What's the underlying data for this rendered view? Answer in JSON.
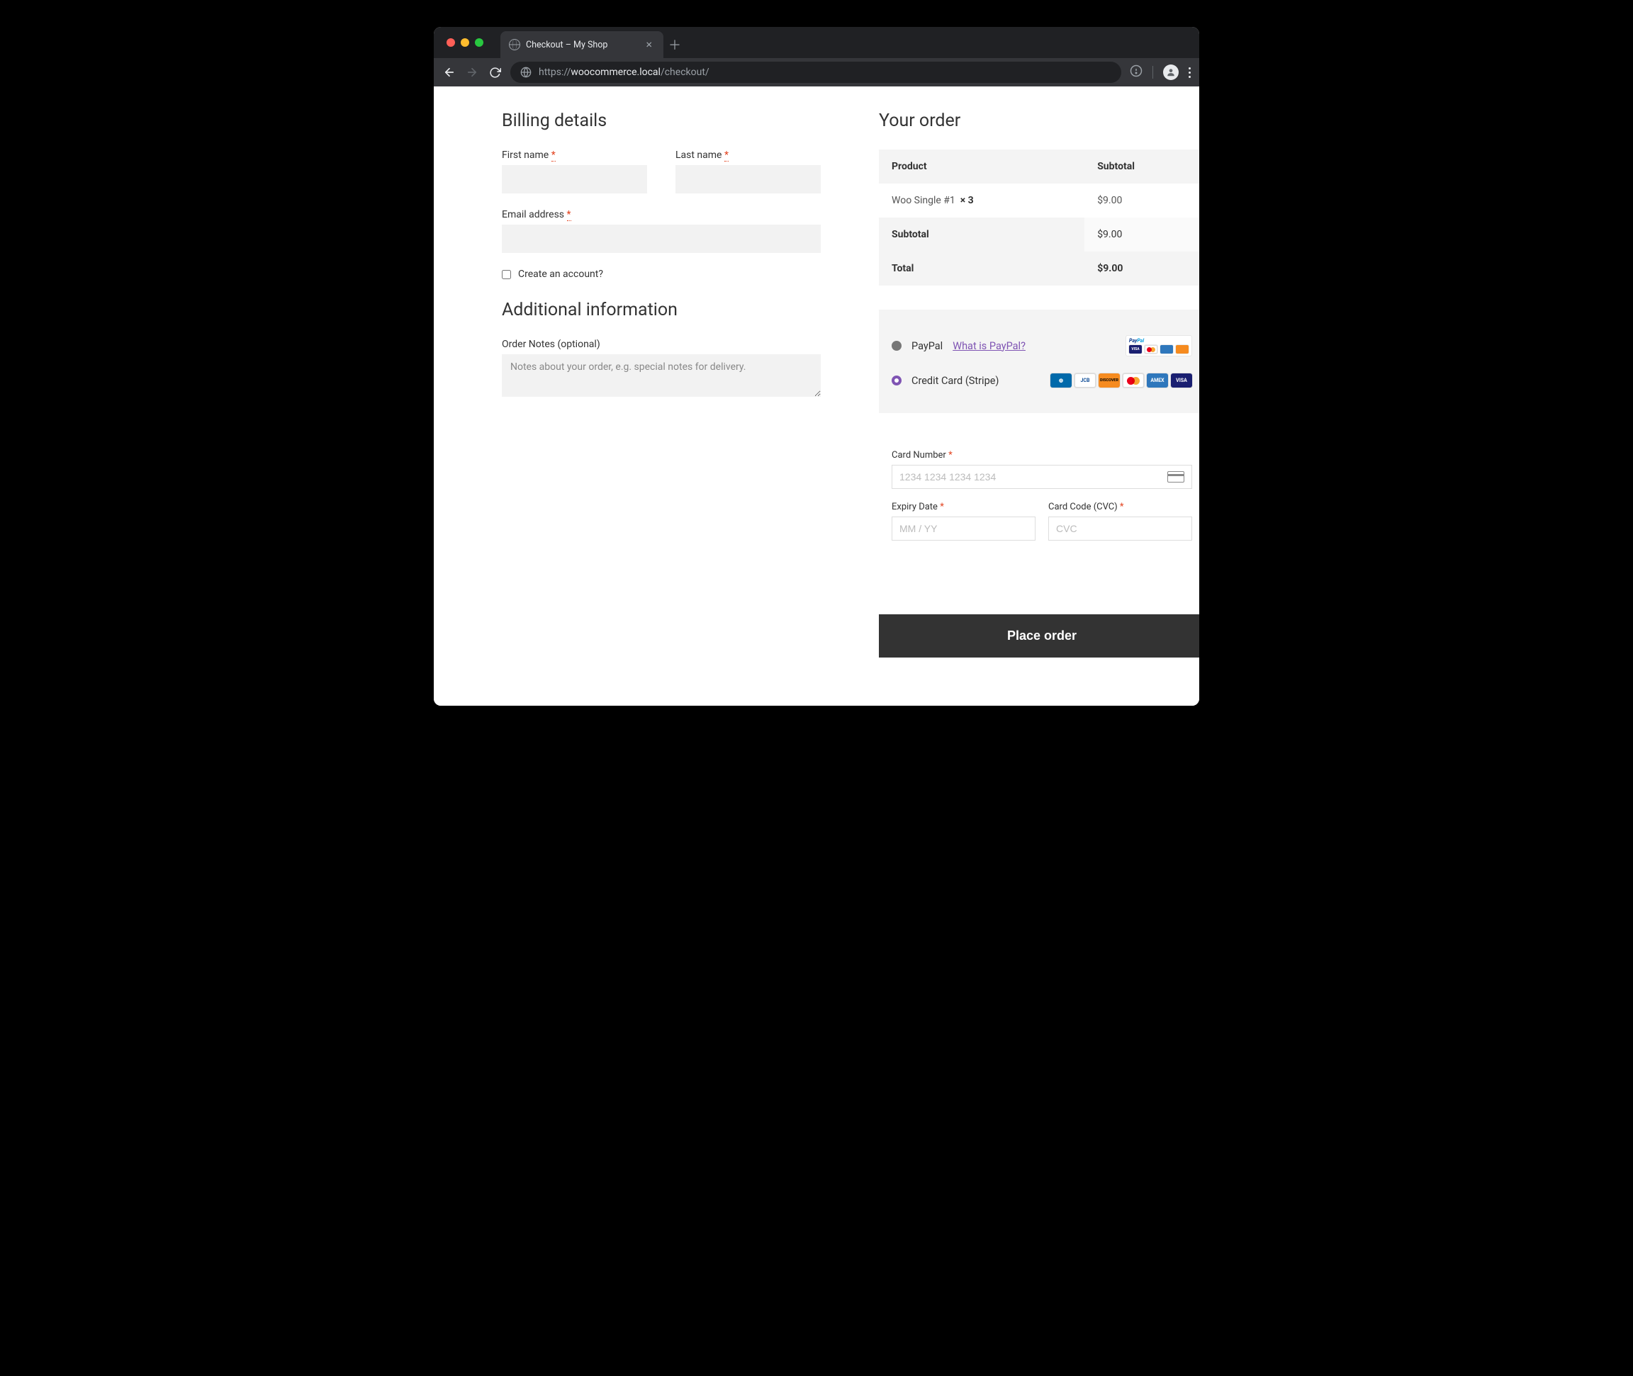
{
  "browser": {
    "tab_title": "Checkout – My Shop",
    "url_scheme": "https://",
    "url_host": "woocommerce.local",
    "url_path": "/checkout/"
  },
  "billing": {
    "heading": "Billing details",
    "first_name_label": "First name",
    "last_name_label": "Last name",
    "email_label": "Email address",
    "create_account_label": "Create an account?"
  },
  "additional": {
    "heading": "Additional information",
    "notes_label": "Order Notes (optional)",
    "notes_placeholder": "Notes about your order, e.g. special notes for delivery."
  },
  "order": {
    "heading": "Your order",
    "col_product": "Product",
    "col_subtotal": "Subtotal",
    "items": [
      {
        "name": "Woo Single #1",
        "qty": "× 3",
        "subtotal": "$9.00"
      }
    ],
    "subtotal_label": "Subtotal",
    "subtotal_value": "$9.00",
    "total_label": "Total",
    "total_value": "$9.00"
  },
  "payment": {
    "paypal_label": "PayPal",
    "paypal_link": "What is PayPal?",
    "stripe_label": "Credit Card (Stripe)",
    "card_number_label": "Card Number",
    "card_number_placeholder": "1234 1234 1234 1234",
    "expiry_label": "Expiry Date",
    "expiry_placeholder": "MM / YY",
    "cvc_label": "Card Code (CVC)",
    "cvc_placeholder": "CVC"
  },
  "actions": {
    "place_order": "Place order"
  }
}
